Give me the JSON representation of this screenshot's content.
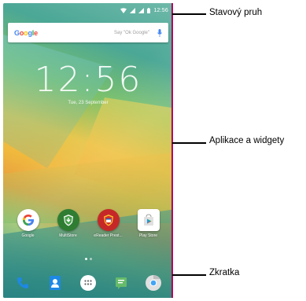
{
  "status_bar": {
    "time": "12:56",
    "wifi_icon": "wifi-icon",
    "signal_icons": [
      "signal-icon",
      "signal-icon"
    ],
    "battery_icon": "battery-icon"
  },
  "search_widget": {
    "logo_letters": [
      "G",
      "o",
      "o",
      "g",
      "l",
      "e"
    ],
    "hint": "Say \"Ok Google\"",
    "mic_icon": "mic-icon"
  },
  "clock": {
    "time": "12:56",
    "date": "Tue, 23 September"
  },
  "apps": [
    {
      "label": "Google",
      "icon": "google-icon"
    },
    {
      "label": "MultiStore",
      "icon": "multistore-icon"
    },
    {
      "label": "eReader Prest...",
      "icon": "ereader-icon"
    },
    {
      "label": "Play Store",
      "icon": "play-store-icon"
    }
  ],
  "dock": [
    {
      "icon": "phone-icon"
    },
    {
      "icon": "contacts-icon"
    },
    {
      "icon": "app-drawer-icon"
    },
    {
      "icon": "messages-icon"
    },
    {
      "icon": "chrome-icon"
    }
  ],
  "callouts": {
    "status_bar": "Stavový pruh",
    "apps_widgets": "Aplikace a widgety",
    "shortcut": "Zkratka"
  },
  "colors": {
    "bracket": "#b4005a",
    "google_blue": "#4285f4",
    "google_red": "#ea4335",
    "google_yellow": "#fbbc05",
    "google_green": "#34a853"
  }
}
